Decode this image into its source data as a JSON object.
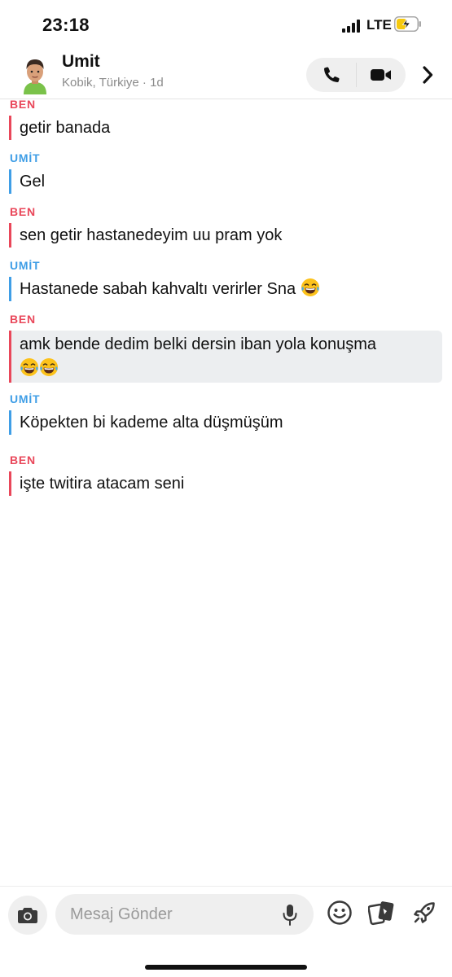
{
  "status_bar": {
    "time": "23:18",
    "network": "LTE",
    "battery_level": 0.5
  },
  "header": {
    "contact_name": "Umit",
    "subtitle": "Kobik, Türkiye · 1d",
    "icons": [
      "avatar",
      "phone-icon",
      "video-icon",
      "chevron-right-icon"
    ]
  },
  "messages": [
    {
      "sender": "BEN",
      "text": "getir banada",
      "emoji_count": 0,
      "highlighted": false
    },
    {
      "sender": "UMİT",
      "text": "Gel",
      "emoji_count": 0,
      "highlighted": false
    },
    {
      "sender": "BEN",
      "text": "sen getir hastanedeyim uu pram yok",
      "emoji_count": 0,
      "highlighted": false
    },
    {
      "sender": "UMİT",
      "text": "Hastanede sabah kahvaltı verirler Sna",
      "emoji_count": 1,
      "highlighted": false
    },
    {
      "sender": "BEN",
      "text": "amk bende dedim belki dersin iban yola konuşma",
      "emoji_count": 2,
      "highlighted": true
    },
    {
      "sender": "UMİT",
      "text": "Köpekten bi kademe alta düşmüşüm",
      "emoji_count": 0,
      "highlighted": false
    },
    {
      "sender": "BEN",
      "text": "işte twitira atacam seni",
      "emoji_count": 0,
      "highlighted": false
    }
  ],
  "composer": {
    "placeholder": "Mesaj Gönder",
    "value": "",
    "icons": [
      "camera-icon",
      "microphone-icon",
      "smiley-icon",
      "stickers-icon",
      "rocket-icon"
    ]
  },
  "colors": {
    "ben": "#e9475a",
    "umit": "#3f9ee6",
    "highlight_bg": "#eceef0"
  }
}
